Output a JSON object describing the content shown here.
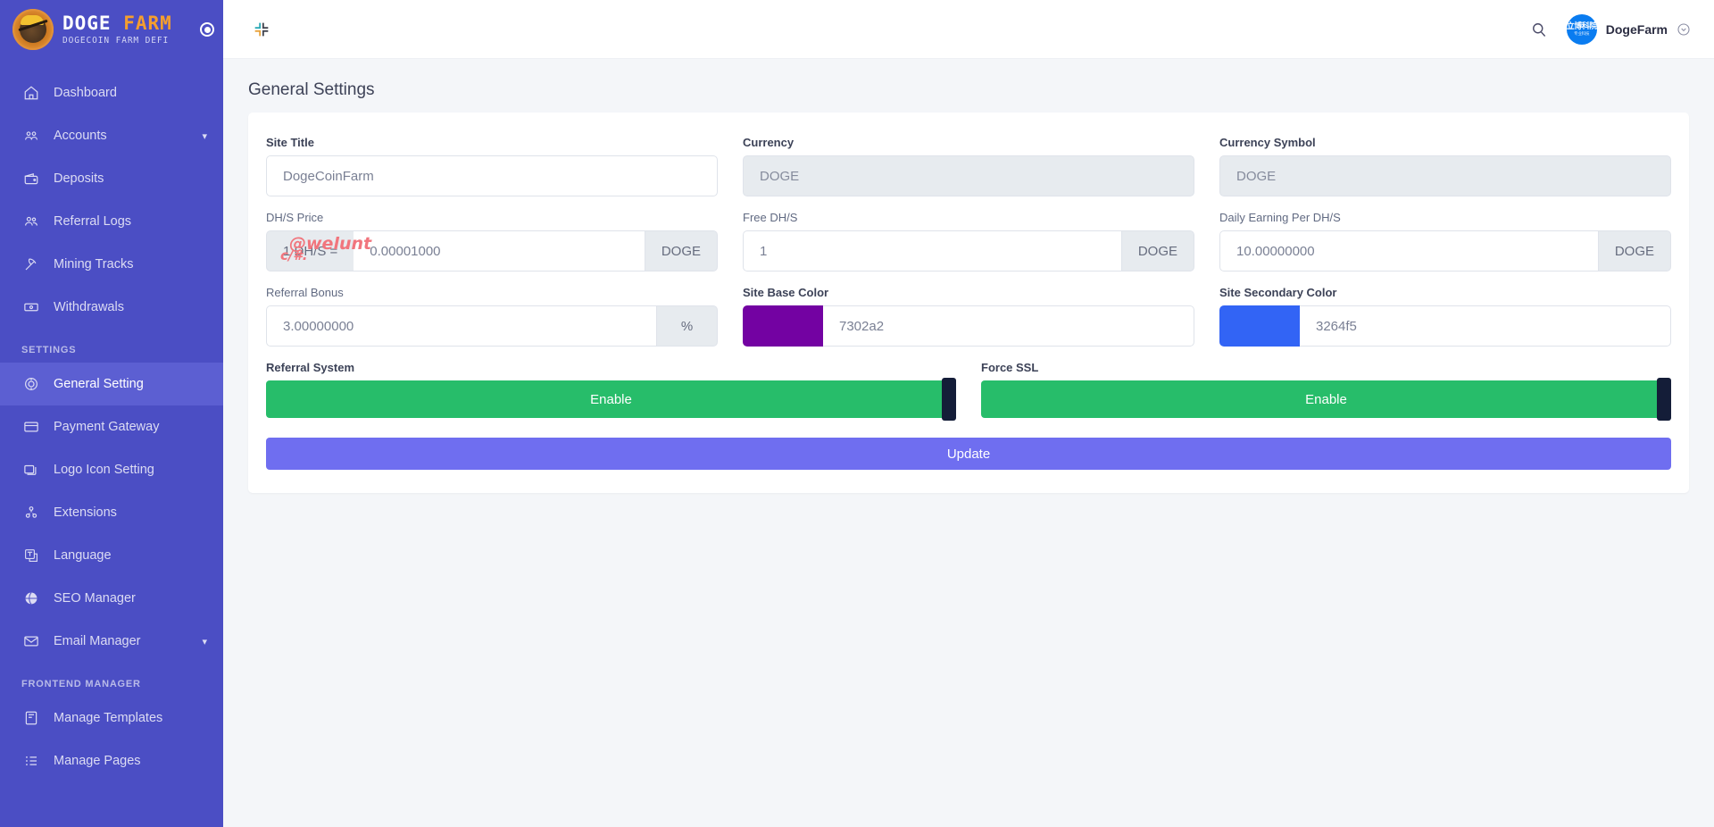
{
  "brand": {
    "title_part1": "DOGE",
    "title_part2": "FARM",
    "subtitle": "DOGECOIN FARM DEFI"
  },
  "sidebar": {
    "items": [
      {
        "label": "Dashboard",
        "icon": "home-icon",
        "active": false,
        "caret": ""
      },
      {
        "label": "Accounts",
        "icon": "users-group-icon",
        "active": false,
        "caret": "▾"
      },
      {
        "label": "Deposits",
        "icon": "wallet-icon",
        "active": false,
        "caret": ""
      },
      {
        "label": "Referral Logs",
        "icon": "people-icon",
        "active": false,
        "caret": ""
      },
      {
        "label": "Mining Tracks",
        "icon": "pickaxe-icon",
        "active": false,
        "caret": ""
      },
      {
        "label": "Withdrawals",
        "icon": "banknote-icon",
        "active": false,
        "caret": ""
      }
    ],
    "section_settings": "SETTINGS",
    "settings_items": [
      {
        "label": "General Setting",
        "icon": "gear-circle-icon",
        "active": true,
        "caret": ""
      },
      {
        "label": "Payment Gateway",
        "icon": "credit-card-icon",
        "active": false,
        "caret": ""
      },
      {
        "label": "Logo Icon Setting",
        "icon": "images-icon",
        "active": false,
        "caret": ""
      },
      {
        "label": "Extensions",
        "icon": "puzzle-nodes-icon",
        "active": false,
        "caret": ""
      },
      {
        "label": "Language",
        "icon": "language-icon",
        "active": false,
        "caret": ""
      },
      {
        "label": "SEO Manager",
        "icon": "globe-icon",
        "active": false,
        "caret": ""
      },
      {
        "label": "Email Manager",
        "icon": "envelope-icon",
        "active": false,
        "caret": "▾"
      }
    ],
    "section_frontend": "FRONTEND MANAGER",
    "frontend_items": [
      {
        "label": "Manage Templates",
        "icon": "template-icon",
        "active": false,
        "caret": ""
      },
      {
        "label": "Manage Pages",
        "icon": "list-icon",
        "active": false,
        "caret": ""
      }
    ]
  },
  "topbar": {
    "collapse_icon": "compress-icon",
    "search_icon": "search-icon",
    "avatar_line1": "立博科院",
    "avatar_line2": "专业科技",
    "user_name": "DogeFarm",
    "chevron_icon": "chevron-down-circle-icon"
  },
  "page": {
    "title": "General Settings"
  },
  "form": {
    "site_title": {
      "label": "Site Title",
      "value": "DogeCoinFarm"
    },
    "currency": {
      "label": "Currency",
      "value": "DOGE"
    },
    "currency_symbol": {
      "label": "Currency Symbol",
      "value": "DOGE"
    },
    "dhs_price": {
      "label": "DH/S Price",
      "prefix": "1 DH/S =",
      "value": "0.00001000",
      "suffix": "DOGE"
    },
    "free_dhs": {
      "label": "Free DH/S",
      "value": "1",
      "suffix": "DOGE"
    },
    "daily_earning": {
      "label": "Daily Earning Per DH/S",
      "value": "10.00000000",
      "suffix": "DOGE"
    },
    "referral_bonus": {
      "label": "Referral Bonus",
      "value": "3.00000000",
      "suffix": "%"
    },
    "site_base_color": {
      "label": "Site Base Color",
      "value": "7302a2",
      "hex": "#7302a2"
    },
    "site_secondary_color": {
      "label": "Site Secondary Color",
      "value": "3264f5",
      "hex": "#3264f5"
    },
    "referral_system": {
      "label": "Referral System",
      "state": "Enable"
    },
    "force_ssl": {
      "label": "Force SSL",
      "state": "Enable"
    },
    "update_button": "Update"
  },
  "watermark": {
    "line1": "@welunt",
    "line2": "c/#."
  },
  "colors": {
    "accent": "#6f6ef0",
    "sidebar": "#4b4ec4",
    "toggle_on": "#27bd6a",
    "brand_orange": "#f59e2e"
  }
}
